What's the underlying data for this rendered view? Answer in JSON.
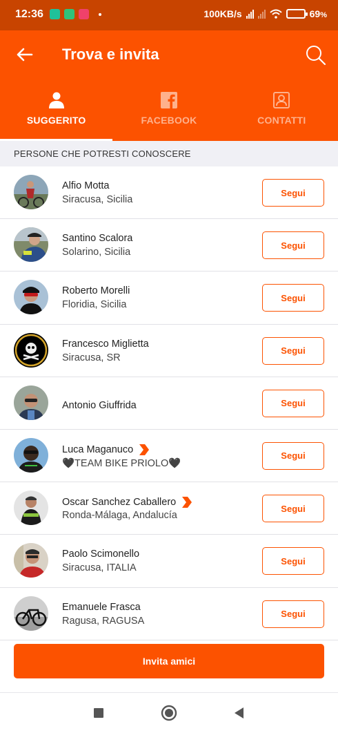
{
  "status_bar": {
    "time": "12:36",
    "network_speed": "100KB/s",
    "battery_percent": "69",
    "battery_unit": "%",
    "battery_level": 0.69
  },
  "header": {
    "title": "Trova e invita",
    "back_icon": "arrow-left-icon",
    "search_icon": "search-icon"
  },
  "tabs": [
    {
      "label": "SUGGERITO",
      "icon": "person-icon",
      "active": true
    },
    {
      "label": "FACEBOOK",
      "icon": "facebook-icon",
      "active": false
    },
    {
      "label": "CONTATTI",
      "icon": "contacts-icon",
      "active": false
    }
  ],
  "section_title": "PERSONE CHE POTRESTI CONOSCERE",
  "people": [
    {
      "name": "Alfio Motta",
      "location": "Siracusa, Sicilia",
      "follow_label": "Segui"
    },
    {
      "name": "Santino Scalora",
      "location": "Solarino, Sicilia",
      "follow_label": "Segui"
    },
    {
      "name": "Roberto Morelli",
      "location": "Floridia, Sicilia",
      "follow_label": "Segui"
    },
    {
      "name": "Francesco Miglietta",
      "location": "Siracusa, SR",
      "follow_label": "Segui"
    },
    {
      "name": "Antonio Giuffrida",
      "location": "",
      "follow_label": "Segui"
    },
    {
      "name": "Luca Maganuco",
      "location": "🖤TEAM BIKE PRIOLO🖤",
      "follow_label": "Segui",
      "subscriber": true
    },
    {
      "name": "Oscar Sanchez Caballero",
      "location": "Ronda-Málaga, Andalucía",
      "follow_label": "Segui",
      "subscriber": true
    },
    {
      "name": "Paolo Scimonello",
      "location": "Siracusa, ITALIA",
      "follow_label": "Segui"
    },
    {
      "name": "Emanuele Frasca",
      "location": "Ragusa, RAGUSA",
      "follow_label": "Segui"
    }
  ],
  "invite_button": "Invita amici",
  "colors": {
    "brand": "#fc5200",
    "status_bar": "#c84400",
    "section_bg": "#f0f0f5"
  }
}
